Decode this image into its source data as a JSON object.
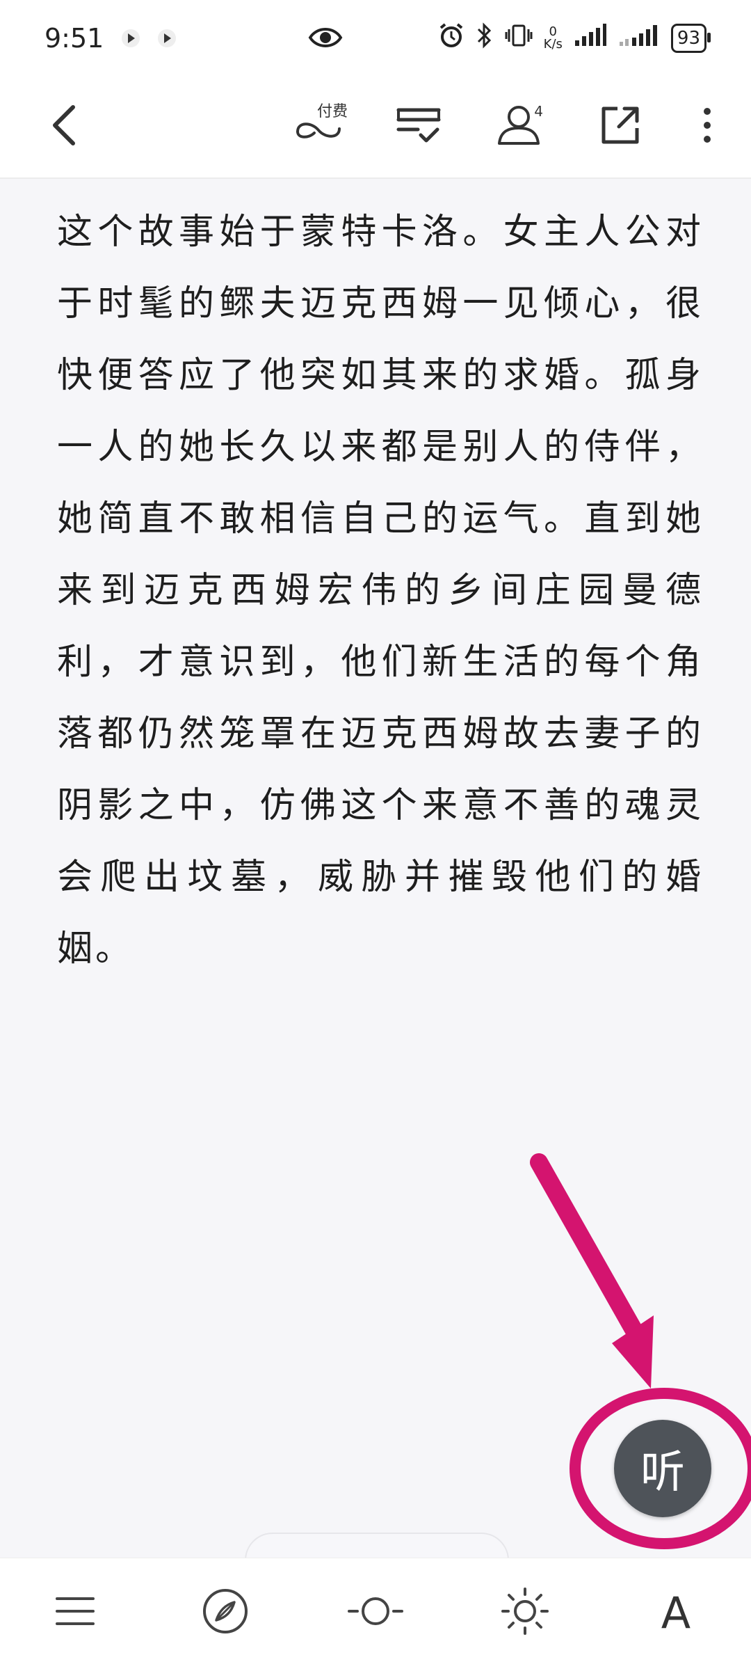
{
  "status_bar": {
    "time": "9:51",
    "net_speed_value": "0",
    "net_speed_unit": "K/s",
    "battery": "93"
  },
  "toolbar": {
    "pay_label": "付费",
    "reader_count": "4"
  },
  "content": {
    "paragraph": "这个故事始于蒙特卡洛。女主人公对于时髦的鳏夫迈克西姆一见倾心，很快便答应了他突如其来的求婚。孤身一人的她长久以来都是别人的侍伴，她简直不敢相信自己的运气。直到她来到迈克西姆宏伟的乡间庄园曼德利，才意识到，他们新生活的每个角落都仍然笼罩在迈克西姆故去妻子的阴影之中，仿佛这个来意不善的魂灵会爬出坟墓，威胁并摧毁他们的婚姻。"
  },
  "listen_button": {
    "label": "听"
  },
  "bottom_bar": {
    "font_label": "A"
  },
  "colors": {
    "annotation": "#d4146f",
    "listen_bg": "#4e5359",
    "background": "#f6f6f9"
  }
}
